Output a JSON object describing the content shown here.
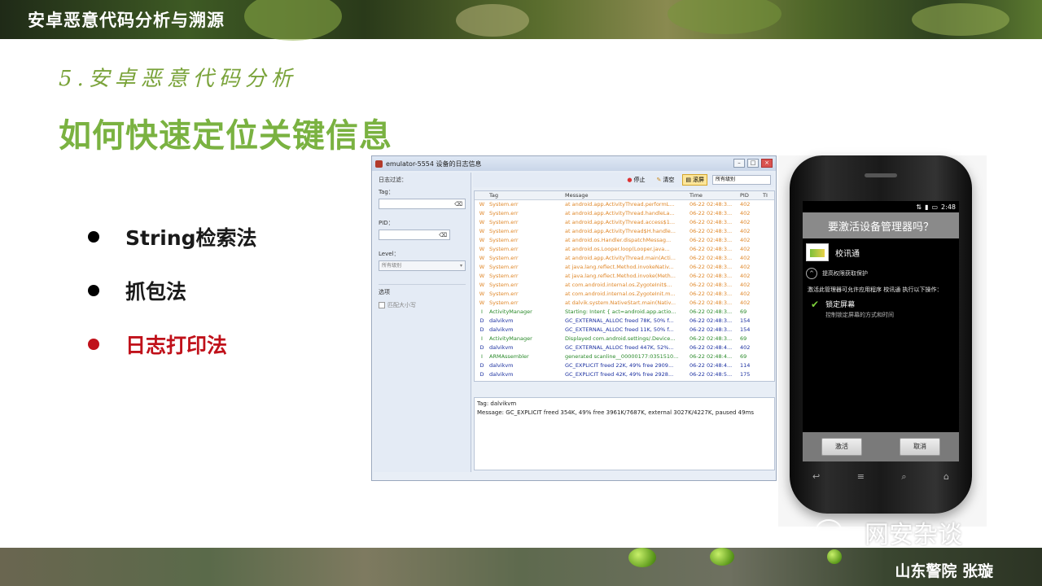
{
  "header": {
    "title": "安卓恶意代码分析与溯源"
  },
  "slide": {
    "subtitle": "5.安卓恶意代码分析",
    "title": "如何快速定位关键信息",
    "bullets": [
      {
        "label": "String检索法",
        "active": false
      },
      {
        "label": "抓包法",
        "active": false
      },
      {
        "label": "日志打印法",
        "active": true
      }
    ]
  },
  "log_window": {
    "title": "emulator-5554 设备的日志信息",
    "filter_title": "日志过滤：",
    "tag_label": "Tag：",
    "pid_label": "PID：",
    "level_label": "Level：",
    "level_value": "所有级别",
    "options_label": "选项",
    "match_case_label": "匹配大小写",
    "toolbar": {
      "stop": "停止",
      "clear": "清空",
      "scroll": "滚屏",
      "level_select": "所有级别"
    },
    "columns": [
      "Tag",
      "Message",
      "Time",
      "PID",
      "TI"
    ],
    "rows": [
      {
        "lv": "W",
        "tag": "System.err",
        "msg": "at android.app.ActivityThread.performL...",
        "time": "06-22 02:48:3...",
        "pid": "402"
      },
      {
        "lv": "W",
        "tag": "System.err",
        "msg": "at android.app.ActivityThread.handleLa...",
        "time": "06-22 02:48:3...",
        "pid": "402"
      },
      {
        "lv": "W",
        "tag": "System.err",
        "msg": "at android.app.ActivityThread.access$1...",
        "time": "06-22 02:48:3...",
        "pid": "402"
      },
      {
        "lv": "W",
        "tag": "System.err",
        "msg": "at android.app.ActivityThread$H.handle...",
        "time": "06-22 02:48:3...",
        "pid": "402"
      },
      {
        "lv": "W",
        "tag": "System.err",
        "msg": "at android.os.Handler.dispatchMessag...",
        "time": "06-22 02:48:3...",
        "pid": "402"
      },
      {
        "lv": "W",
        "tag": "System.err",
        "msg": "at android.os.Looper.loop(Looper.java...",
        "time": "06-22 02:48:3...",
        "pid": "402"
      },
      {
        "lv": "W",
        "tag": "System.err",
        "msg": "at android.app.ActivityThread.main(Acti...",
        "time": "06-22 02:48:3...",
        "pid": "402"
      },
      {
        "lv": "W",
        "tag": "System.err",
        "msg": "at java.lang.reflect.Method.invokeNativ...",
        "time": "06-22 02:48:3...",
        "pid": "402"
      },
      {
        "lv": "W",
        "tag": "System.err",
        "msg": "at java.lang.reflect.Method.invoke(Meth...",
        "time": "06-22 02:48:3...",
        "pid": "402"
      },
      {
        "lv": "W",
        "tag": "System.err",
        "msg": "at com.android.internal.os.ZygoteInit$...",
        "time": "06-22 02:48:3...",
        "pid": "402"
      },
      {
        "lv": "W",
        "tag": "System.err",
        "msg": "at com.android.internal.os.ZygoteInit.m...",
        "time": "06-22 02:48:3...",
        "pid": "402"
      },
      {
        "lv": "W",
        "tag": "System.err",
        "msg": "at dalvik.system.NativeStart.main(Nativ...",
        "time": "06-22 02:48:3...",
        "pid": "402"
      },
      {
        "lv": "I",
        "tag": "ActivityManager",
        "msg": "Starting: Intent { act=android.app.actio...",
        "time": "06-22 02:48:3...",
        "pid": "69"
      },
      {
        "lv": "D",
        "tag": "dalvikvm",
        "msg": "GC_EXTERNAL_ALLOC freed 78K, 50% f...",
        "time": "06-22 02:48:3...",
        "pid": "154"
      },
      {
        "lv": "D",
        "tag": "dalvikvm",
        "msg": "GC_EXTERNAL_ALLOC freed 11K, 50% f...",
        "time": "06-22 02:48:3...",
        "pid": "154"
      },
      {
        "lv": "I",
        "tag": "ActivityManager",
        "msg": "Displayed com.android.settings/.Device...",
        "time": "06-22 02:48:3...",
        "pid": "69"
      },
      {
        "lv": "D",
        "tag": "dalvikvm",
        "msg": "GC_EXTERNAL_ALLOC freed 447K, 52%...",
        "time": "06-22 02:48:4...",
        "pid": "402"
      },
      {
        "lv": "I",
        "tag": "ARMAssembler",
        "msg": "generated scanline__00000177:0351510...",
        "time": "06-22 02:48:4...",
        "pid": "69"
      },
      {
        "lv": "D",
        "tag": "dalvikvm",
        "msg": "GC_EXPLICIT freed 22K, 49% free 2909...",
        "time": "06-22 02:48:4...",
        "pid": "114"
      },
      {
        "lv": "D",
        "tag": "dalvikvm",
        "msg": "GC_EXPLICIT freed 42K, 49% free 2928...",
        "time": "06-22 02:48:5...",
        "pid": "175"
      }
    ],
    "detail": {
      "tag_line": "Tag: dalvikvm",
      "message_line": "Message: GC_EXPLICIT freed 354K, 49% free 3961K/7687K, external 3027K/4227K, paused 49ms"
    }
  },
  "phone": {
    "status_time": "2:48",
    "dialog_title": "要激活设备管理器吗？",
    "app_name": "校讯通",
    "perm_toggle": "提高权限获取保护",
    "description": "激活此管理器可允许应用程序 校讯通 执行以下操作：",
    "permission_title": "锁定屏幕",
    "permission_desc": "控制锁定屏幕的方式和时间",
    "activate_button": "激活",
    "cancel_button": "取消"
  },
  "watermark": {
    "text": "网安杂谈"
  },
  "footer": {
    "author": "山东警院  张璇"
  }
}
